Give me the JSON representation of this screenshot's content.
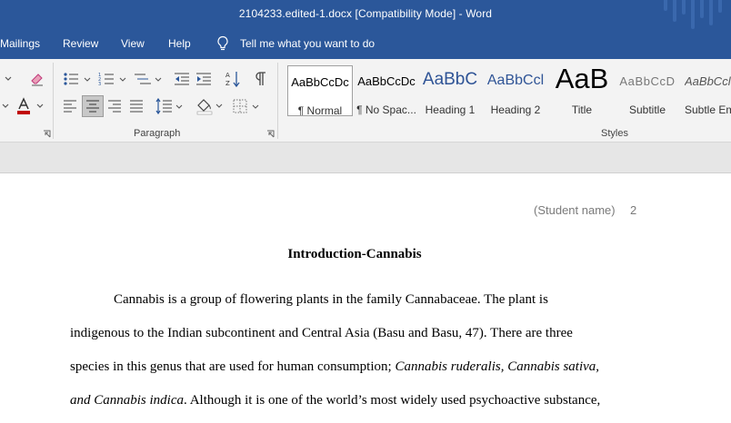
{
  "window": {
    "title": "2104233.edited-1.docx [Compatibility Mode]  -  Word"
  },
  "tabs": [
    {
      "label": "Mailings"
    },
    {
      "label": "Review"
    },
    {
      "label": "View"
    },
    {
      "label": "Help"
    }
  ],
  "tell_me": {
    "label": "Tell me what you want to do",
    "icon": "lightbulb-icon"
  },
  "ribbon": {
    "paragraph_group_label": "Paragraph",
    "styles_group_label": "Styles",
    "font_color": "#c00000",
    "icons": [
      "bullets-icon",
      "numbering-icon",
      "multilevel-list-icon",
      "decrease-indent-icon",
      "increase-indent-icon",
      "sort-icon",
      "show-marks-icon",
      "align-left-icon",
      "align-center-icon",
      "align-right-icon",
      "justify-icon",
      "line-spacing-icon",
      "shading-icon",
      "borders-icon",
      "clear-formatting-icon",
      "font-color-icon"
    ]
  },
  "styles": [
    {
      "sample": "AaBbCcDc",
      "name": "¶ Normal",
      "selected": true
    },
    {
      "sample": "AaBbCcDc",
      "name": "¶ No Spac..."
    },
    {
      "sample": "AaBbC",
      "name": "Heading 1"
    },
    {
      "sample": "AaBbCcl",
      "name": "Heading 2"
    },
    {
      "sample": "AaB",
      "name": "Title"
    },
    {
      "sample": "AaBbCcD",
      "name": "Subtitle"
    },
    {
      "sample": "AaBbCcl",
      "name": "Subtle Em"
    }
  ],
  "document": {
    "header_text": "(Student name)",
    "page_number": "2",
    "title": "Introduction-Cannabis",
    "line1": "Cannabis is a group of flowering plants in the family Cannabaceae. The plant is",
    "line2": "indigenous to the Indian subcontinent and Central Asia (Basu and Basu, 47). There are three",
    "line3_plain": "species in this genus that are used for human consumption; ",
    "line3_italic": "Cannabis ruderalis, Cannabis sativa,",
    "line4_italic": "and Cannabis indica",
    "line4_plain": ". Although it is one of the world’s most widely used psychoactive substance,"
  },
  "colors": {
    "brand_blue": "#2b579a",
    "heading_blue": "#2f5496"
  }
}
